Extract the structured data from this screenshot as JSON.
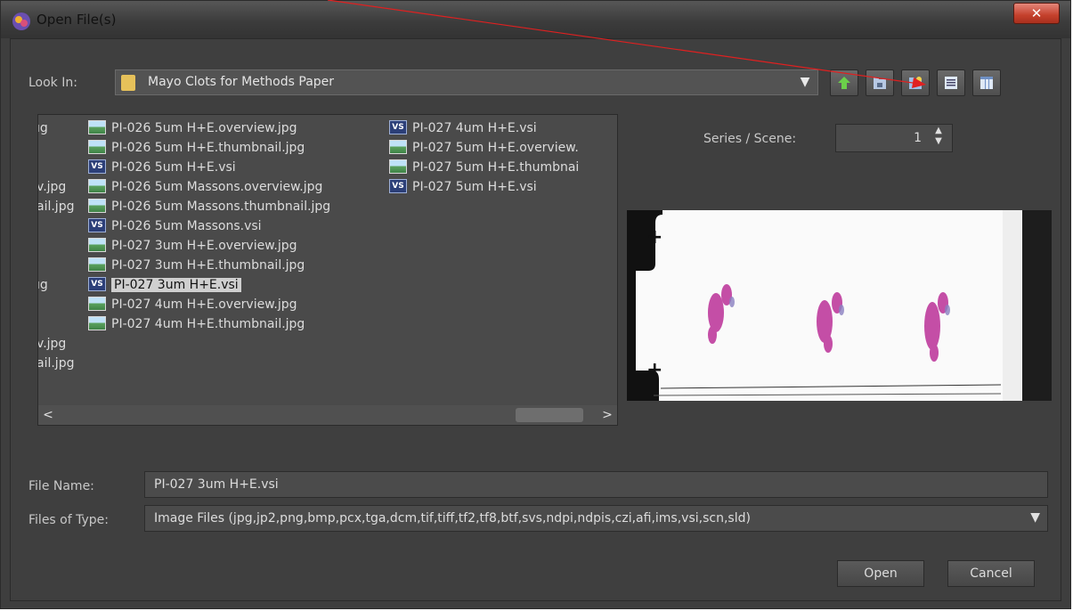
{
  "window": {
    "title": "Open File(s)"
  },
  "lookin": {
    "label": "Look In:",
    "value": "Mayo Clots for Methods Paper"
  },
  "left_column_fragments": [
    "ıg",
    "v.jpg",
    "ail.jpg",
    "ıg",
    "v.jpg",
    "ail.jpg"
  ],
  "files_col1": [
    {
      "name": "PI-026 5um H+E.overview.jpg",
      "type": "img"
    },
    {
      "name": "PI-026 5um H+E.thumbnail.jpg",
      "type": "img"
    },
    {
      "name": "PI-026 5um H+E.vsi",
      "type": "vs"
    },
    {
      "name": "PI-026 5um Massons.overview.jpg",
      "type": "img"
    },
    {
      "name": "PI-026 5um Massons.thumbnail.jpg",
      "type": "img"
    },
    {
      "name": "PI-026 5um Massons.vsi",
      "type": "vs"
    },
    {
      "name": "PI-027 3um H+E.overview.jpg",
      "type": "img"
    },
    {
      "name": "PI-027 3um H+E.thumbnail.jpg",
      "type": "img"
    },
    {
      "name": "PI-027 3um H+E.vsi",
      "type": "vs",
      "selected": true
    },
    {
      "name": "PI-027 4um H+E.overview.jpg",
      "type": "img"
    },
    {
      "name": "PI-027 4um H+E.thumbnail.jpg",
      "type": "img"
    }
  ],
  "files_col2": [
    {
      "name": "PI-027 4um H+E.vsi",
      "type": "vs"
    },
    {
      "name": "PI-027 5um H+E.overview.",
      "type": "img"
    },
    {
      "name": "PI-027 5um H+E.thumbnai",
      "type": "img"
    },
    {
      "name": "PI-027 5um H+E.vsi",
      "type": "vs"
    }
  ],
  "icon_text": {
    "vs": "VS"
  },
  "series": {
    "label": "Series / Scene:",
    "value": "1"
  },
  "filename": {
    "label": "File Name:",
    "value": "PI-027 3um H+E.vsi"
  },
  "filetype": {
    "label": "Files of Type:",
    "value": "Image Files (jpg,jp2,png,bmp,pcx,tga,dcm,tif,tiff,tf2,tf8,btf,svs,ndpi,ndpis,czi,afi,ims,vsi,scn,sld)"
  },
  "buttons": {
    "open": "Open",
    "cancel": "Cancel"
  },
  "toolbar": [
    "up-one-level-icon",
    "home-folder-icon",
    "new-folder-icon",
    "list-view-icon",
    "details-view-icon"
  ],
  "colors": {
    "annotation_arrow": "#e02020",
    "background": "#3f3f3f",
    "selected": "#cfcfcf"
  }
}
